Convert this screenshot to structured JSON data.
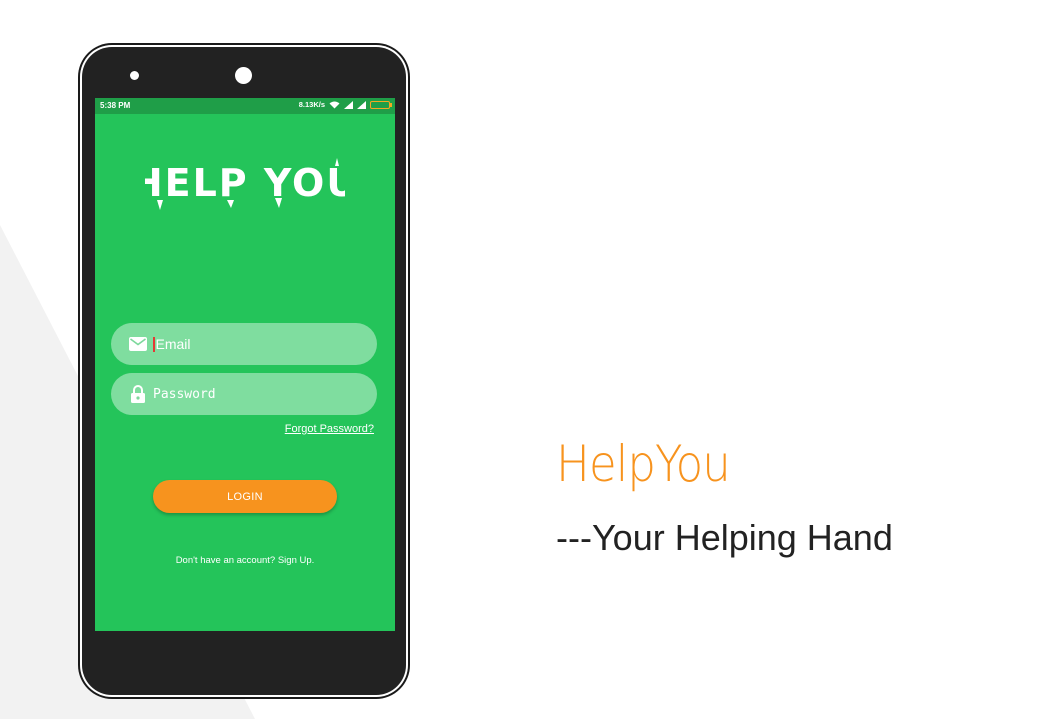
{
  "colors": {
    "screen_green": "#24c45a",
    "status_green": "#1f9e48",
    "accent_orange": "#f7931e",
    "phone_body": "#222222"
  },
  "statusbar": {
    "time": "5:38 PM",
    "speed": "8.13K/s",
    "icons": [
      "wifi-icon",
      "signal-icon",
      "signal-icon",
      "battery-icon"
    ]
  },
  "logo": {
    "text": "HELP YOU"
  },
  "form": {
    "email_placeholder": "Email",
    "email_icon": "mail-icon",
    "password_placeholder": "Password",
    "password_icon": "lock-icon",
    "forgot_label": "Forgot Password?",
    "login_label": "LOGIN",
    "signup_text": "Don't have an account? Sign Up."
  },
  "promo": {
    "title": "HelpYou",
    "tagline": "---Your Helping Hand"
  }
}
